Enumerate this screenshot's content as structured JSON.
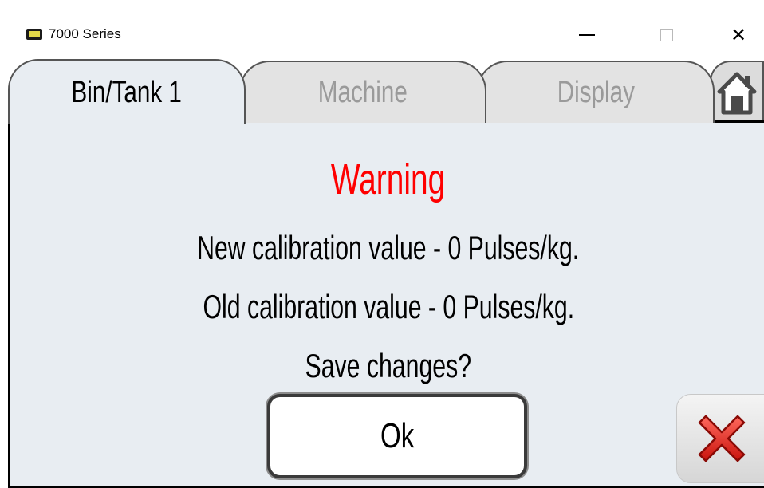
{
  "window": {
    "title": "7000 Series",
    "icon": "app-icon",
    "controls": [
      "minimize-icon",
      "maximize-icon",
      "close-icon"
    ],
    "close_glyph": "✕"
  },
  "tabs": [
    {
      "label": "Bin/Tank 1",
      "active": true
    },
    {
      "label": "Machine",
      "active": false
    },
    {
      "label": "Display",
      "active": false
    }
  ],
  "home_button": {
    "icon": "home-icon"
  },
  "dialog": {
    "heading": "Warning",
    "new_value_line": "New calibration value - 0 Pulses/kg.",
    "old_value_line": "Old calibration value - 0 Pulses/kg.",
    "prompt": "Save changes?",
    "ok_label": "Ok",
    "cancel_icon": "red-x-icon"
  },
  "colors": {
    "warning": "#ff0000",
    "panel_background": "#e8edf2",
    "inactive_tab_text": "#9a9a9a"
  }
}
